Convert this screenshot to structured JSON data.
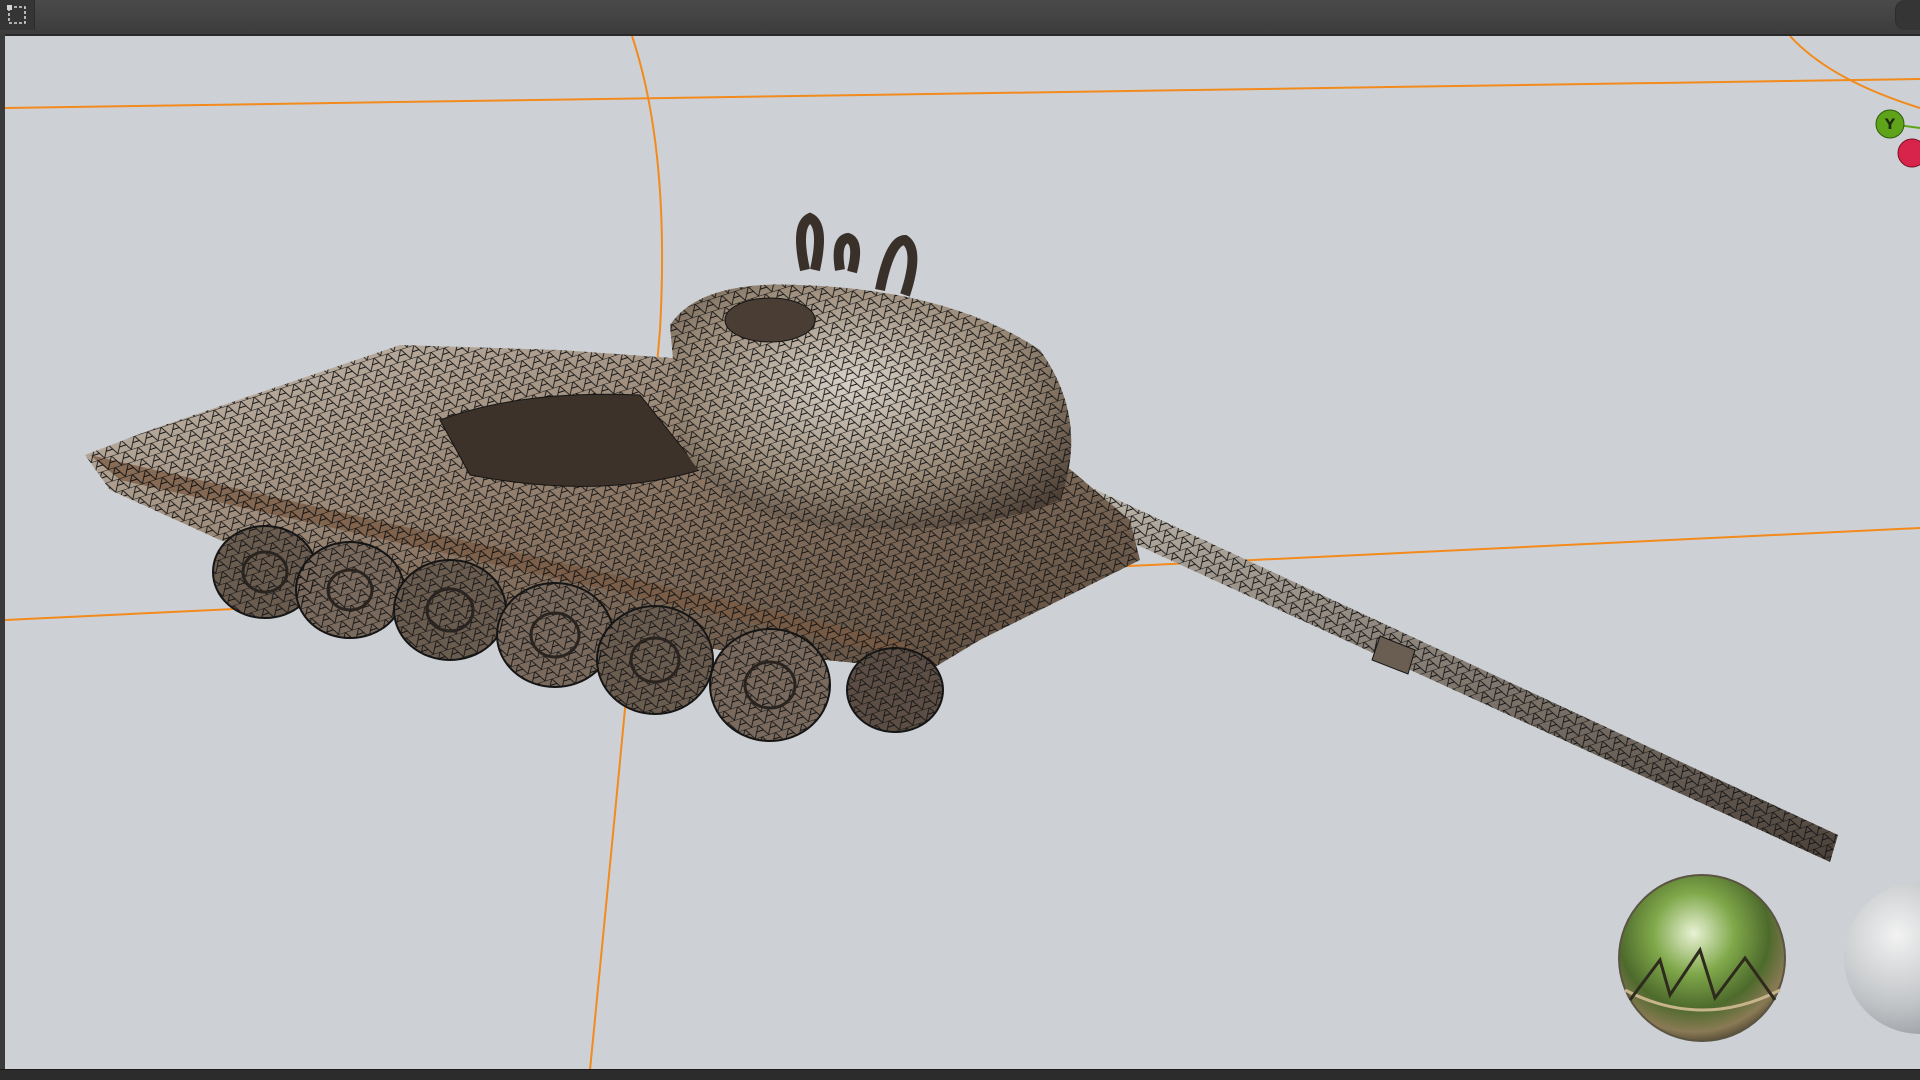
{
  "toolbar": {
    "select_tool_icon": "selection-rectangle-icon",
    "corner_button_icon": "view-options-icon"
  },
  "viewport": {
    "background_color": "#cdd1d6",
    "grid_line_color": "#f28a1c",
    "object": "wireframe-tank-model",
    "render_mode": "wireframe-textured"
  },
  "gizmo": {
    "y_axis_label": "Y",
    "y_axis_color": "#5fa31a",
    "x_axis_color": "#d8234a"
  },
  "hdri": {
    "environment_preview": "hdri-environment-sphere",
    "material_preview": "matcap-sphere"
  }
}
